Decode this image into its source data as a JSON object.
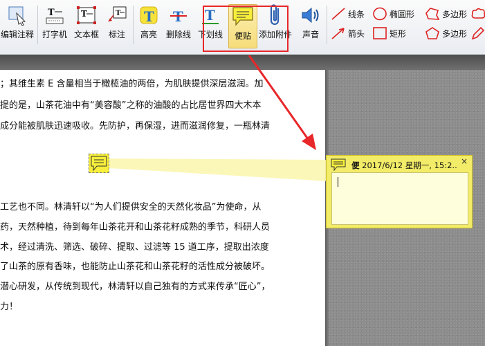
{
  "toolbar": {
    "edit_annotation": "编辑注释",
    "typewriter": "打字机",
    "textbox": "文本框",
    "callout": "标注",
    "highlight": "高亮",
    "strikethrough": "删除线",
    "underline": "下划线",
    "sticky_note": "便贴",
    "attach_file": "添加附件",
    "sound": "声音"
  },
  "shapes": {
    "line": "线条",
    "ellipse": "椭圆形",
    "polygon": "多边形",
    "arrow": "箭头",
    "rectangle": "矩形",
    "polygon2": "多边形"
  },
  "document": {
    "lines": [
      "；其维生素 E 含量相当于橄榄油的两倍，为肌肤提供深层滋润。加",
      "提的是，山茶花油中有“美容酸”之称的油酸的占比居世界四大木本",
      "成分能被肌肤迅速吸收。先防护，再保湿，进而滋润修复，一瓶林清",
      "工艺也不同。林清轩以“为人们提供安全的天然化妆品”为使命，从",
      "药，天然种植，待到每年山茶花开和山茶花籽成熟的季节，科研人员",
      "术，经过清洗、筛选、破碎、提取、过滤等 15 道工序，提取出浓度",
      "了山茶的原有香味，也能防止山茶花和山茶花籽的活性成分被破坏。",
      "潜心研发，从传统到现代，林清轩以自己独有的方式来传承“匠心”，",
      "力！"
    ]
  },
  "note": {
    "author": "便",
    "timestamp": "2017/6/12 星期一, 15:2..",
    "close": "×",
    "body_text": ""
  },
  "colors": {
    "highlight_red": "#e8272a",
    "note_yellow": "#f2ec68"
  }
}
